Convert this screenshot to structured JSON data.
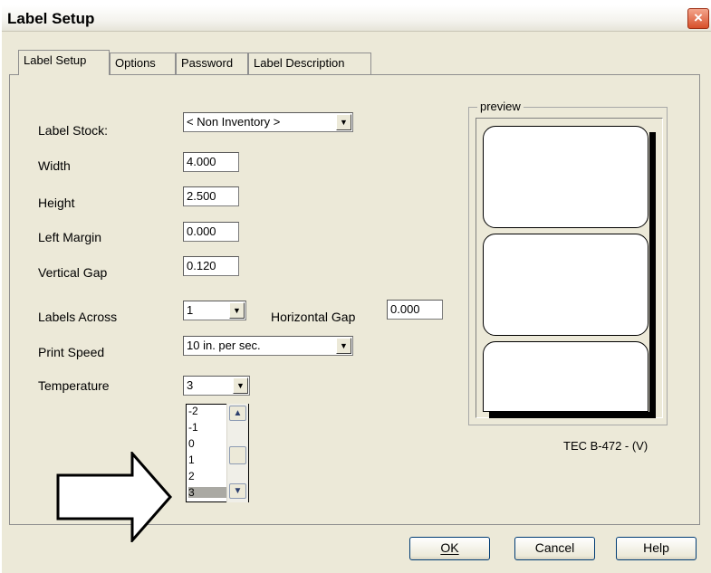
{
  "window": {
    "title": "Label Setup",
    "close_symbol": "×"
  },
  "tabs": [
    {
      "label": "Label Setup",
      "active": true
    },
    {
      "label": "Options",
      "active": false
    },
    {
      "label": "Password",
      "active": false
    },
    {
      "label": "Label Description",
      "active": false
    }
  ],
  "form": {
    "label_stock": {
      "label": "Label Stock:",
      "value": "< Non Inventory >"
    },
    "width": {
      "label": "Width",
      "value": "4.000"
    },
    "height": {
      "label": "Height",
      "value": "2.500"
    },
    "left_margin": {
      "label": "Left Margin",
      "value": "0.000"
    },
    "vertical_gap": {
      "label": "Vertical Gap",
      "value": "0.120"
    },
    "labels_across": {
      "label": "Labels Across",
      "value": "1"
    },
    "horizontal_gap": {
      "label": "Horizontal Gap",
      "value": "0.000"
    },
    "print_speed": {
      "label": "Print Speed",
      "value": "10 in. per sec."
    },
    "temperature": {
      "label": "Temperature",
      "value": "3"
    }
  },
  "temperature_options": [
    "-2",
    "-1",
    "0",
    "1",
    "2",
    "3"
  ],
  "temperature_selected": "3",
  "preview": {
    "legend": "preview",
    "printer": "TEC B-472 - (V)"
  },
  "buttons": {
    "ok": "OK",
    "cancel": "Cancel",
    "help": "Help"
  },
  "colors": {
    "selected_item": "#aaa9a3",
    "dialog_bg": "#ece9d8",
    "close_button": "#d7502a"
  }
}
